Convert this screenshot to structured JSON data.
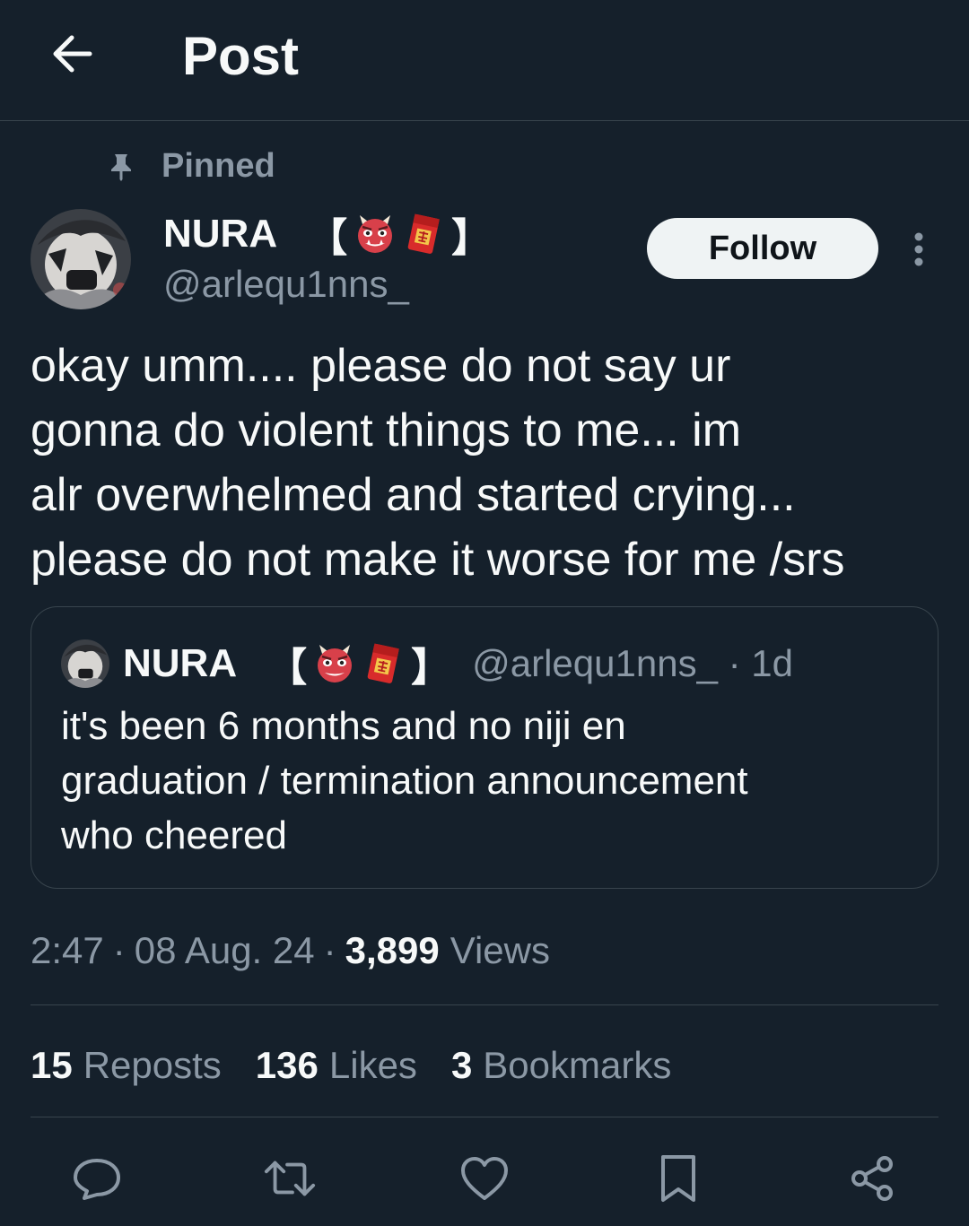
{
  "header": {
    "title": "Post",
    "back_icon": "arrow-left-icon"
  },
  "post": {
    "pinned_label": "Pinned",
    "author": {
      "display_name": "NURA",
      "bracket_open": "【",
      "bracket_close": "】",
      "name_emojis": [
        "ogre-emoji",
        "red-envelope-emoji"
      ],
      "handle": "@arlequ1nns_"
    },
    "follow_label": "Follow",
    "text": "okay umm.... please do not say ur\ngonna do violent things to me... im\nalr overwhelmed and started crying...\nplease do not make it worse for me /srs",
    "quote": {
      "display_name": "NURA",
      "bracket_open": "【",
      "bracket_close": "】",
      "handle_and_time": "@arlequ1nns_ · 1d",
      "text": "it's been 6 months and no niji en\ngraduation / termination announcement\nwho cheered"
    },
    "time": "2:47",
    "date": "08 Aug. 24",
    "sep": "·",
    "views_count": "3,899",
    "views_label": "Views",
    "stats": {
      "reposts_count": "15",
      "reposts_label": "Reposts",
      "likes_count": "136",
      "likes_label": "Likes",
      "bookmarks_count": "3",
      "bookmarks_label": "Bookmarks"
    }
  },
  "actions": [
    "reply-icon",
    "repost-icon",
    "like-icon",
    "bookmark-icon",
    "share-icon"
  ],
  "colors": {
    "background": "#15202b",
    "text_primary": "#f7f9f9",
    "text_secondary": "#8b98a5",
    "border": "#38444d",
    "follow_bg": "#eff3f4"
  }
}
